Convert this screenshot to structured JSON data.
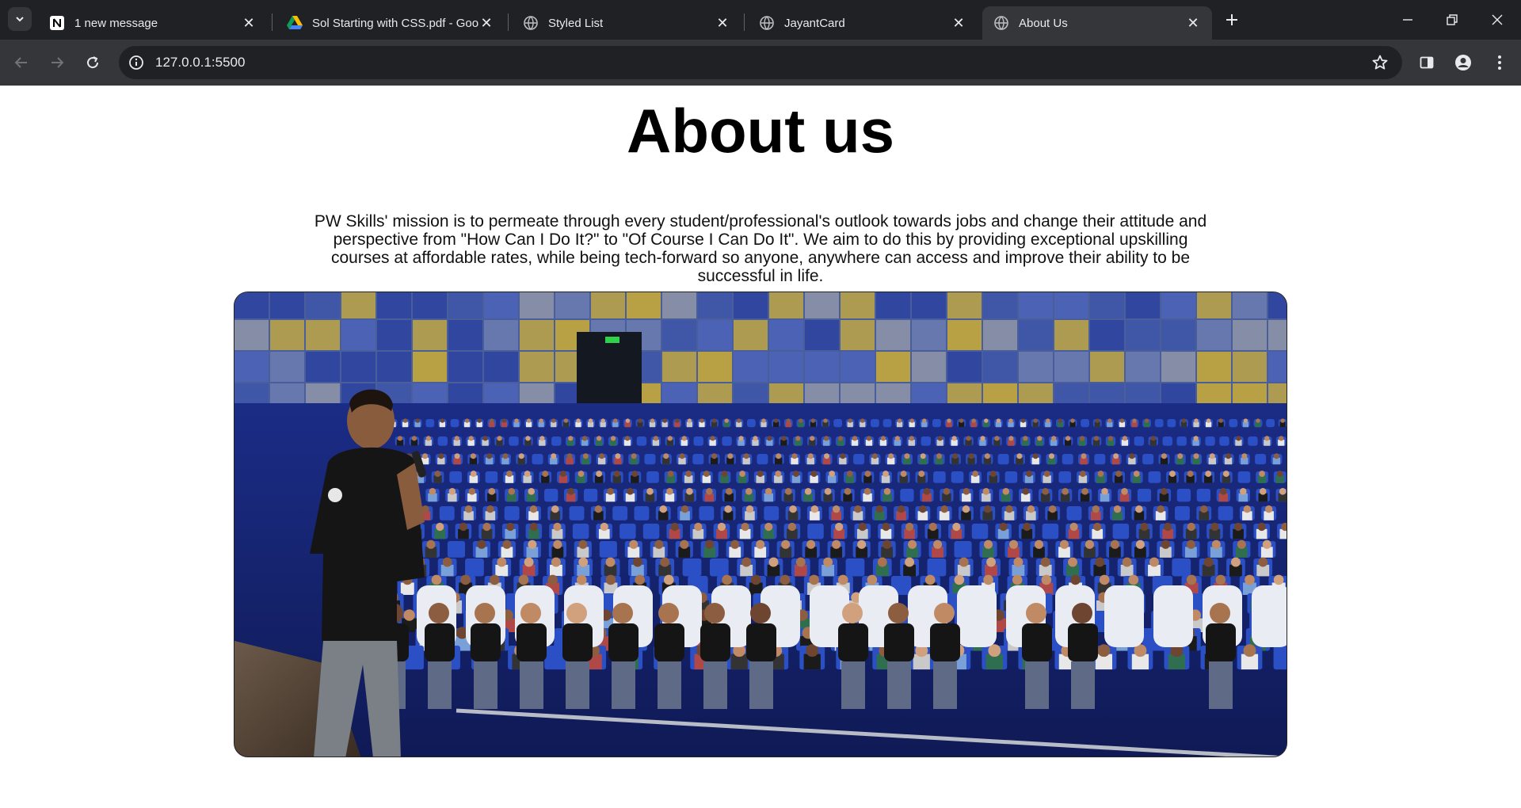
{
  "browser": {
    "tabs": [
      {
        "title": "1 new message",
        "favicon": "notion-icon",
        "active": false
      },
      {
        "title": "Sol Starting with CSS.pdf - Goo",
        "favicon": "google-drive-icon",
        "active": false
      },
      {
        "title": "Styled List",
        "favicon": "globe-icon",
        "active": false
      },
      {
        "title": "JayantCard",
        "favicon": "globe-icon",
        "active": false
      },
      {
        "title": "About Us",
        "favicon": "globe-icon",
        "active": true
      }
    ],
    "url": "127.0.0.1:5500"
  },
  "page": {
    "title": "About us",
    "mission": "PW Skills' mission is to permeate through every student/professional's outlook towards jobs and change their attitude and perspective from \"How Can I Do It?\" to \"Of Course I Can Do It\". We aim to do this by providing exceptional upskilling courses at affordable rates, while being tech-forward so anyone, anywhere can access and improve their ability to be successful in life.",
    "image": {
      "subject": "speaker-addressing-auditorium-audience"
    }
  },
  "colors": {
    "chrome_dark": "#202124",
    "chrome_mid": "#35363a",
    "chrome_text": "#e8eaed",
    "page_bg": "#ffffff",
    "seat_blue": "#2b4fc4"
  }
}
